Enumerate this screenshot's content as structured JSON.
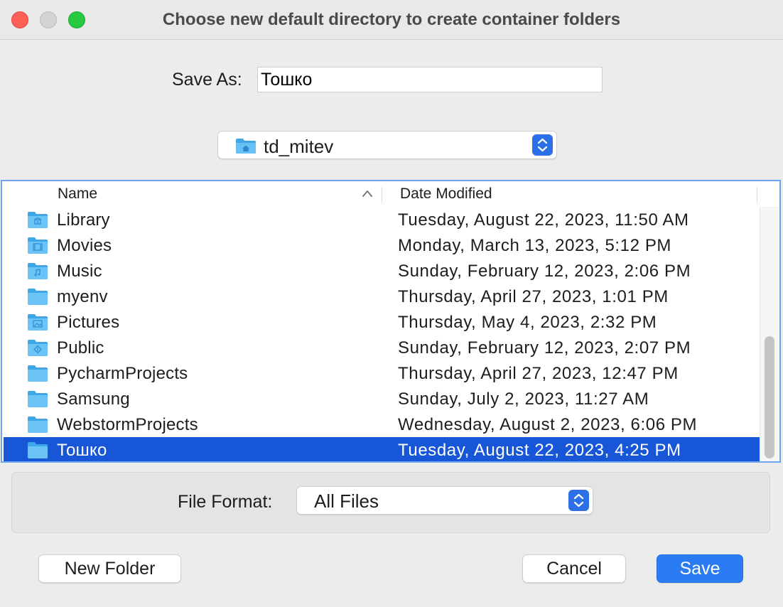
{
  "window": {
    "title": "Choose new default directory to create container folders"
  },
  "save_as": {
    "label": "Save As:",
    "value": "Тошко"
  },
  "location": {
    "label": "td_mitev",
    "icon": "home-folder-icon"
  },
  "columns": {
    "name": "Name",
    "date": "Date Modified"
  },
  "files": [
    {
      "name": "Library",
      "date": "Tuesday, August 22, 2023, 11:50 AM",
      "icon": "library-folder-icon"
    },
    {
      "name": "Movies",
      "date": "Monday, March 13, 2023, 5:12 PM",
      "icon": "movies-folder-icon"
    },
    {
      "name": "Music",
      "date": "Sunday, February 12, 2023, 2:06 PM",
      "icon": "music-folder-icon"
    },
    {
      "name": "myenv",
      "date": "Thursday, April 27, 2023, 1:01 PM",
      "icon": "folder-icon"
    },
    {
      "name": "Pictures",
      "date": "Thursday, May 4, 2023, 2:32 PM",
      "icon": "pictures-folder-icon"
    },
    {
      "name": "Public",
      "date": "Sunday, February 12, 2023, 2:07 PM",
      "icon": "public-folder-icon"
    },
    {
      "name": "PycharmProjects",
      "date": "Thursday, April 27, 2023, 12:47 PM",
      "icon": "folder-icon"
    },
    {
      "name": "Samsung",
      "date": "Sunday, July 2, 2023, 11:27 AM",
      "icon": "folder-icon"
    },
    {
      "name": "WebstormProjects",
      "date": "Wednesday, August 2, 2023, 6:06 PM",
      "icon": "folder-icon"
    },
    {
      "name": "Тошко",
      "date": "Tuesday, August 22, 2023, 4:25 PM",
      "icon": "folder-icon",
      "selected": true
    }
  ],
  "file_format": {
    "label": "File Format:",
    "value": "All Files"
  },
  "buttons": {
    "new_folder": "New Folder",
    "cancel": "Cancel",
    "save": "Save"
  },
  "colors": {
    "accent": "#2b7cf3",
    "selection": "#1756d6",
    "folder": "#5ab8f0"
  }
}
